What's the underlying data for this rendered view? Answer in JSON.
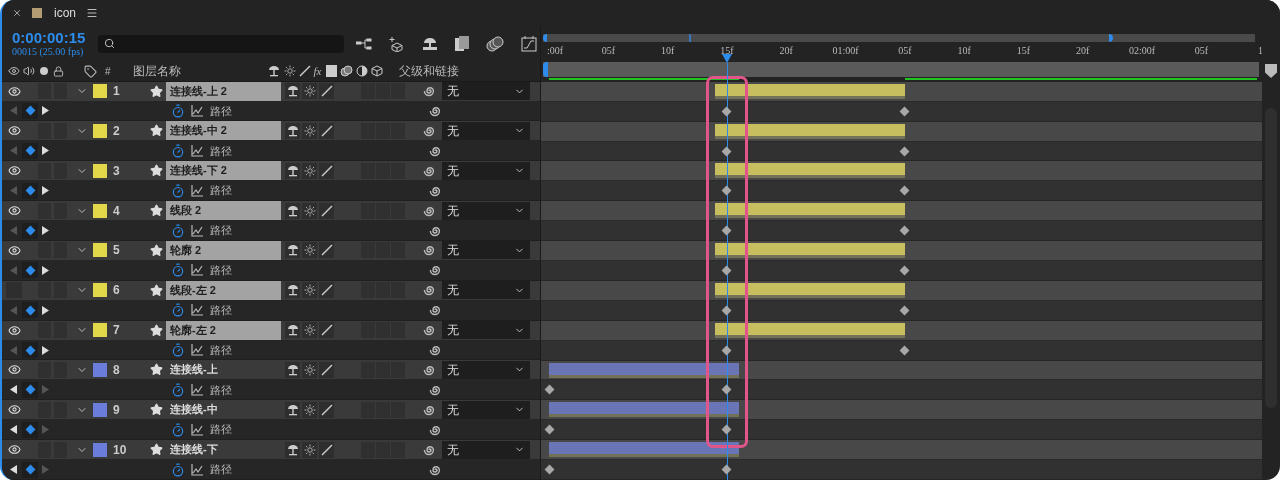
{
  "tab": {
    "title": "icon"
  },
  "timecode": "0:00:00:15",
  "frame_info": "00015 (25.00 fps)",
  "columns": {
    "number": "#",
    "layer_name": "图层名称",
    "effects": "fx",
    "parent": "父级和链接"
  },
  "ruler": {
    "labels": [
      ":00f",
      "05f",
      "10f",
      "15f",
      "20f",
      "01:00f",
      "05f",
      "10f",
      "15f",
      "20f",
      "02:00f",
      "05f",
      "1"
    ]
  },
  "layers": [
    {
      "number": "1",
      "name": "连接线-上 2",
      "color": "#e2d64a",
      "visible": true,
      "selected": true,
      "parent": "无",
      "kind": "late",
      "property": {
        "name": "路径",
        "prev_key": false,
        "next_key": true
      }
    },
    {
      "number": "2",
      "name": "连接线-中 2",
      "color": "#e2d64a",
      "visible": true,
      "selected": true,
      "parent": "无",
      "kind": "late",
      "property": {
        "name": "路径",
        "prev_key": false,
        "next_key": true
      }
    },
    {
      "number": "3",
      "name": "连接线-下 2",
      "color": "#e2d64a",
      "visible": true,
      "selected": true,
      "parent": "无",
      "kind": "late",
      "property": {
        "name": "路径",
        "prev_key": false,
        "next_key": true
      }
    },
    {
      "number": "4",
      "name": "线段 2",
      "color": "#e2d64a",
      "visible": true,
      "selected": true,
      "parent": "无",
      "kind": "late",
      "property": {
        "name": "路径",
        "prev_key": false,
        "next_key": true
      }
    },
    {
      "number": "5",
      "name": "轮廓 2",
      "color": "#e2d64a",
      "visible": true,
      "selected": true,
      "parent": "无",
      "kind": "late",
      "property": {
        "name": "路径",
        "prev_key": false,
        "next_key": true
      }
    },
    {
      "number": "6",
      "name": "线段-左 2",
      "color": "#e2d64a",
      "visible": false,
      "selected": true,
      "parent": "无",
      "kind": "late",
      "property": {
        "name": "路径",
        "prev_key": false,
        "next_key": true
      }
    },
    {
      "number": "7",
      "name": "轮廓-左 2",
      "color": "#e2d64a",
      "visible": true,
      "selected": true,
      "parent": "无",
      "kind": "late",
      "property": {
        "name": "路径",
        "prev_key": false,
        "next_key": true
      }
    },
    {
      "number": "8",
      "name": "连接线-上",
      "color": "#6b7ddb",
      "visible": true,
      "selected": false,
      "parent": "无",
      "kind": "early",
      "property": {
        "name": "路径",
        "prev_key": true,
        "next_key": false
      }
    },
    {
      "number": "9",
      "name": "连接线-中",
      "color": "#6b7ddb",
      "visible": true,
      "selected": false,
      "parent": "无",
      "kind": "early",
      "property": {
        "name": "路径",
        "prev_key": true,
        "next_key": false
      }
    },
    {
      "number": "10",
      "name": "连接线-下",
      "color": "#6b7ddb",
      "visible": true,
      "selected": false,
      "parent": "无",
      "kind": "early",
      "property": {
        "name": "路径",
        "prev_key": true,
        "next_key": false
      }
    }
  ]
}
